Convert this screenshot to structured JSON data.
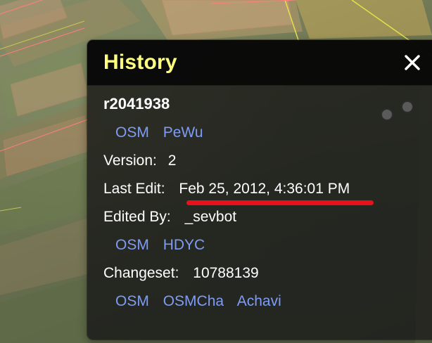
{
  "panel": {
    "title": "History",
    "close_glyph": "✕",
    "entity_id": "r2041938",
    "entity_links": [
      "OSM",
      "PeWu"
    ],
    "version_label": "Version:",
    "version_value": "2",
    "last_edit_label": "Last Edit:",
    "last_edit_value": "Feb 25, 2012, 4:36:01 PM",
    "edited_by_label": "Edited By:",
    "edited_by_value": "_sevbot",
    "user_links": [
      "OSM",
      "HDYC"
    ],
    "changeset_label": "Changeset:",
    "changeset_value": "10788139",
    "changeset_links": [
      "OSM",
      "OSMCha",
      "Achavi"
    ]
  },
  "colors": {
    "title": "#ffff80",
    "link": "#7f9cf5",
    "highlight_underline": "#e8101a",
    "panel_bg": "#161616"
  },
  "icons": {
    "close": "close-icon"
  }
}
